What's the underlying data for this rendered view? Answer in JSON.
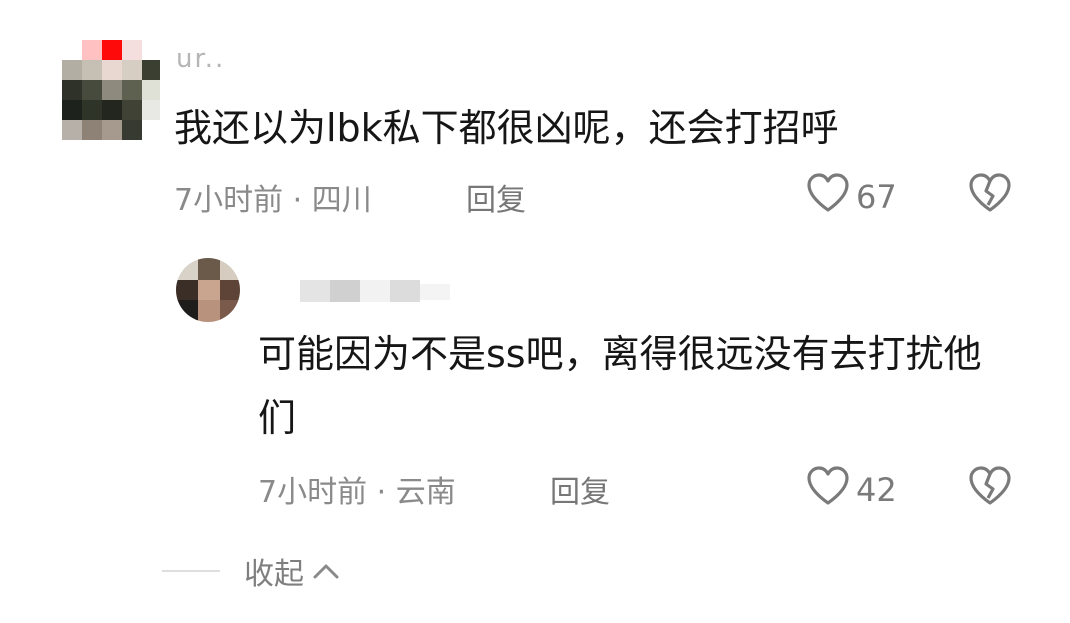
{
  "comment": {
    "username": "ur..",
    "text": "我还以为lbk私下都很凶呢，还会打招呼",
    "time_location": "7小时前 · 四川",
    "reply_label": "回复",
    "like_count": "67",
    "icons": {
      "like": "heart-outline-icon",
      "dislike": "broken-heart-icon"
    }
  },
  "reply": {
    "text": "可能因为不是ss吧，离得很远没有去打扰他们",
    "time_location": "7小时前 · 云南",
    "reply_label": "回复",
    "like_count": "42",
    "icons": {
      "like": "heart-outline-icon",
      "dislike": "broken-heart-icon"
    }
  },
  "collapse": {
    "label": "收起",
    "icon": "chevron-up-icon"
  },
  "colors": {
    "text_primary": "#161616",
    "text_meta": "#8a8a8a",
    "icon_gray": "#7a7a7a"
  }
}
